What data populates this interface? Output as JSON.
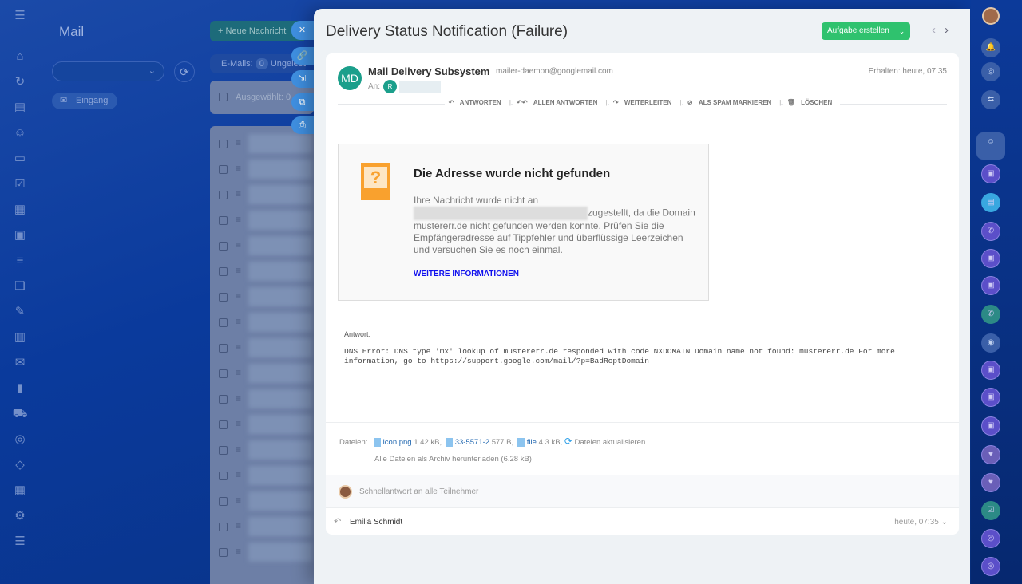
{
  "left": {
    "title": "Mail",
    "folder": "Eingang",
    "new_message": "Neue Nachricht",
    "emails_label": "E-Mails:",
    "emails_count": "0",
    "unread_label": "Ungelesen",
    "selected_label": "Ausgewählt: 0"
  },
  "side_actions": [
    "close-icon",
    "link-icon",
    "download-icon",
    "external-link-icon",
    "print-icon"
  ],
  "email": {
    "subject": "Delivery Status Notification (Failure)",
    "task_button": "Aufgabe erstellen",
    "sender_initials": "MD",
    "sender_name": "Mail Delivery Subsystem",
    "sender_email": "mailer-daemon@googlemail.com",
    "received": "Erhalten: heute, 07:35",
    "to_label": "An:",
    "recipient_initial": "R",
    "actions": [
      "ANTWORTEN",
      "ALLEN ANTWORTEN",
      "WEITERLEITEN",
      "ALS SPAM MARKIEREN",
      "LÖSCHEN"
    ],
    "box_title": "Die Adresse wurde nicht gefunden",
    "box_text_1": "Ihre Nachricht wurde nicht an",
    "box_text_2": "zugestellt, da die Domain mustererr.de nicht gefunden werden konnte. Prüfen Sie die Empfängeradresse auf Tippfehler und überflüssige Leerzeichen und versuchen Sie es noch einmal.",
    "box_link": "WEITERE INFORMATIONEN",
    "answer_label": "Antwort:",
    "dns_text": "DNS Error: DNS type 'mx' lookup of mustererr.de responded with code NXDOMAIN Domain name not found: mustererr.de For more information, go to https://support.google.com/mail/?p=BadRcptDomain",
    "files_label": "Dateien:",
    "files": [
      {
        "name": "icon.png",
        "size": "1.42 kB,"
      },
      {
        "name": "33-5571-2",
        "size": "577 B,"
      },
      {
        "name": "file",
        "size": "4.3 kB,"
      }
    ],
    "refresh_files": "Dateien aktualisieren",
    "download_all": "Alle Dateien als Archiv herunterladen (6.28 kB)",
    "quick_reply": "Schnellantwort an alle Teilnehmer",
    "history_name": "Emilia Schmidt",
    "history_date": "heute, 07:35"
  }
}
